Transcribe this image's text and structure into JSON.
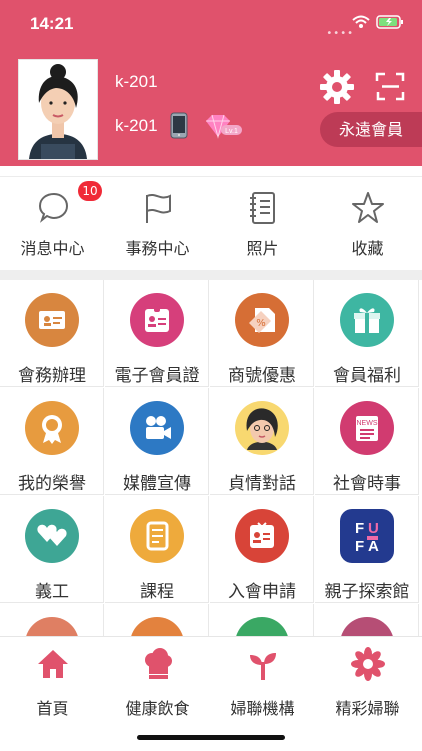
{
  "status": {
    "time": "14:21"
  },
  "profile": {
    "name": "k-201",
    "device_name": "k-201",
    "level": "Lv.1",
    "member_label": "永遠會員"
  },
  "quickbar": [
    {
      "label": "消息中心",
      "icon": "chat-bubble-icon",
      "badge": "10"
    },
    {
      "label": "事務中心",
      "icon": "flag-icon"
    },
    {
      "label": "照片",
      "icon": "notebook-icon"
    },
    {
      "label": "收藏",
      "icon": "star-icon"
    }
  ],
  "grid": [
    {
      "label": "會務辦理",
      "icon": "id-card-icon",
      "color": "#d8863f"
    },
    {
      "label": "電子會員證",
      "icon": "member-badge-icon",
      "color": "#d63f7b"
    },
    {
      "label": "商號優惠",
      "icon": "discount-tag-icon",
      "color": "#d66e35"
    },
    {
      "label": "會員福利",
      "icon": "gift-icon",
      "color": "#3eb6a2"
    },
    {
      "label": "我的榮譽",
      "icon": "medal-icon",
      "color": "#e79b3f"
    },
    {
      "label": "媒體宣傳",
      "icon": "video-camera-icon",
      "color": "#2d79c4"
    },
    {
      "label": "貞情對話",
      "icon": "woman-portrait-icon",
      "color": "#f8d870"
    },
    {
      "label": "社會時事",
      "icon": "news-icon",
      "color": "#d13b70"
    },
    {
      "label": "義工",
      "icon": "hearts-icon",
      "color": "#3ea695"
    },
    {
      "label": "課程",
      "icon": "course-book-icon",
      "color": "#eeaa3c"
    },
    {
      "label": "入會申請",
      "icon": "application-card-icon",
      "color": "#d84438"
    },
    {
      "label": "親子探索館",
      "icon": "fufa-logo-icon",
      "color": "#233a8f"
    },
    {
      "label": "",
      "icon": "partial-icon",
      "color": "#df7f63"
    },
    {
      "label": "",
      "icon": "partial-icon",
      "color": "#e3823e"
    },
    {
      "label": "",
      "icon": "partial-icon",
      "color": "#3aa864"
    },
    {
      "label": "",
      "icon": "partial-icon",
      "color": "#b64e75"
    }
  ],
  "tabs": [
    {
      "label": "首頁",
      "icon": "home-icon"
    },
    {
      "label": "健康飲食",
      "icon": "chef-hat-icon"
    },
    {
      "label": "婦聯機構",
      "icon": "sprout-icon"
    },
    {
      "label": "精彩婦聯",
      "icon": "flower-icon"
    }
  ]
}
